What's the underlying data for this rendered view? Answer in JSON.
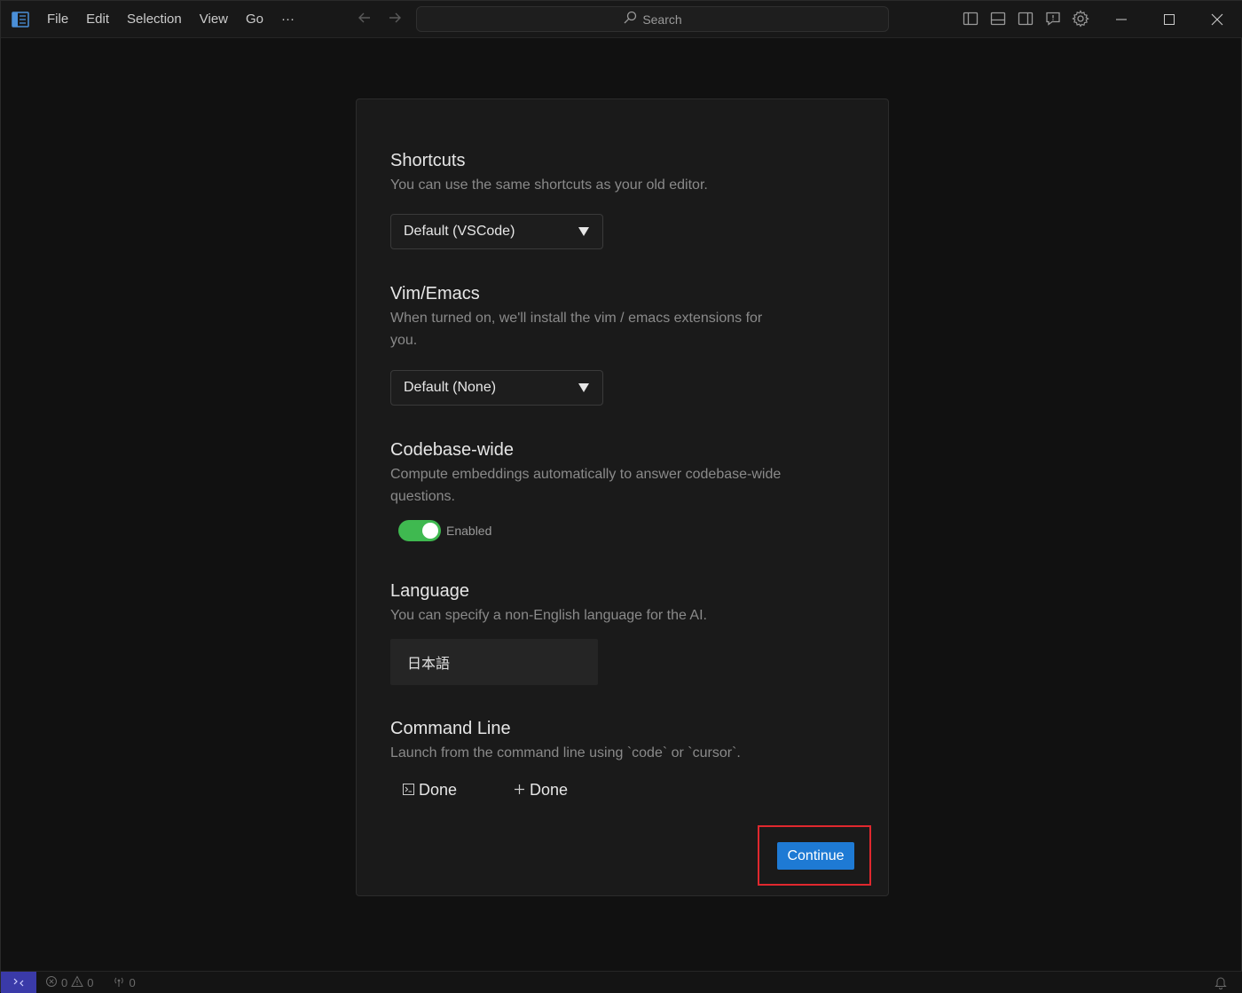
{
  "titlebar": {
    "menu": [
      "File",
      "Edit",
      "Selection",
      "View",
      "Go",
      "···"
    ],
    "search_label": "Search"
  },
  "onboarding": {
    "shortcuts": {
      "title": "Shortcuts",
      "description": "You can use the same shortcuts as your old editor.",
      "selected": "Default (VSCode)"
    },
    "vim_emacs": {
      "title": "Vim/Emacs",
      "description": "When turned on, we'll install the vim / emacs extensions for you.",
      "selected": "Default (None)"
    },
    "codebase": {
      "title": "Codebase-wide",
      "description": "Compute embeddings automatically to answer codebase-wide questions.",
      "toggle_label": "Enabled",
      "toggle_on": true
    },
    "language": {
      "title": "Language",
      "description": "You can specify a non-English language for the AI.",
      "value": "日本語"
    },
    "command_line": {
      "title": "Command Line",
      "description": "Launch from the command line using `code` or `cursor`.",
      "button_1": "Done",
      "button_2": "Done"
    },
    "continue_label": "Continue"
  },
  "statusbar": {
    "errors": "0",
    "warnings": "0",
    "ports": "0"
  },
  "colors": {
    "accent": "#1e7ad4",
    "toggle_on": "#3fb950",
    "highlight_box": "#e0282e"
  }
}
